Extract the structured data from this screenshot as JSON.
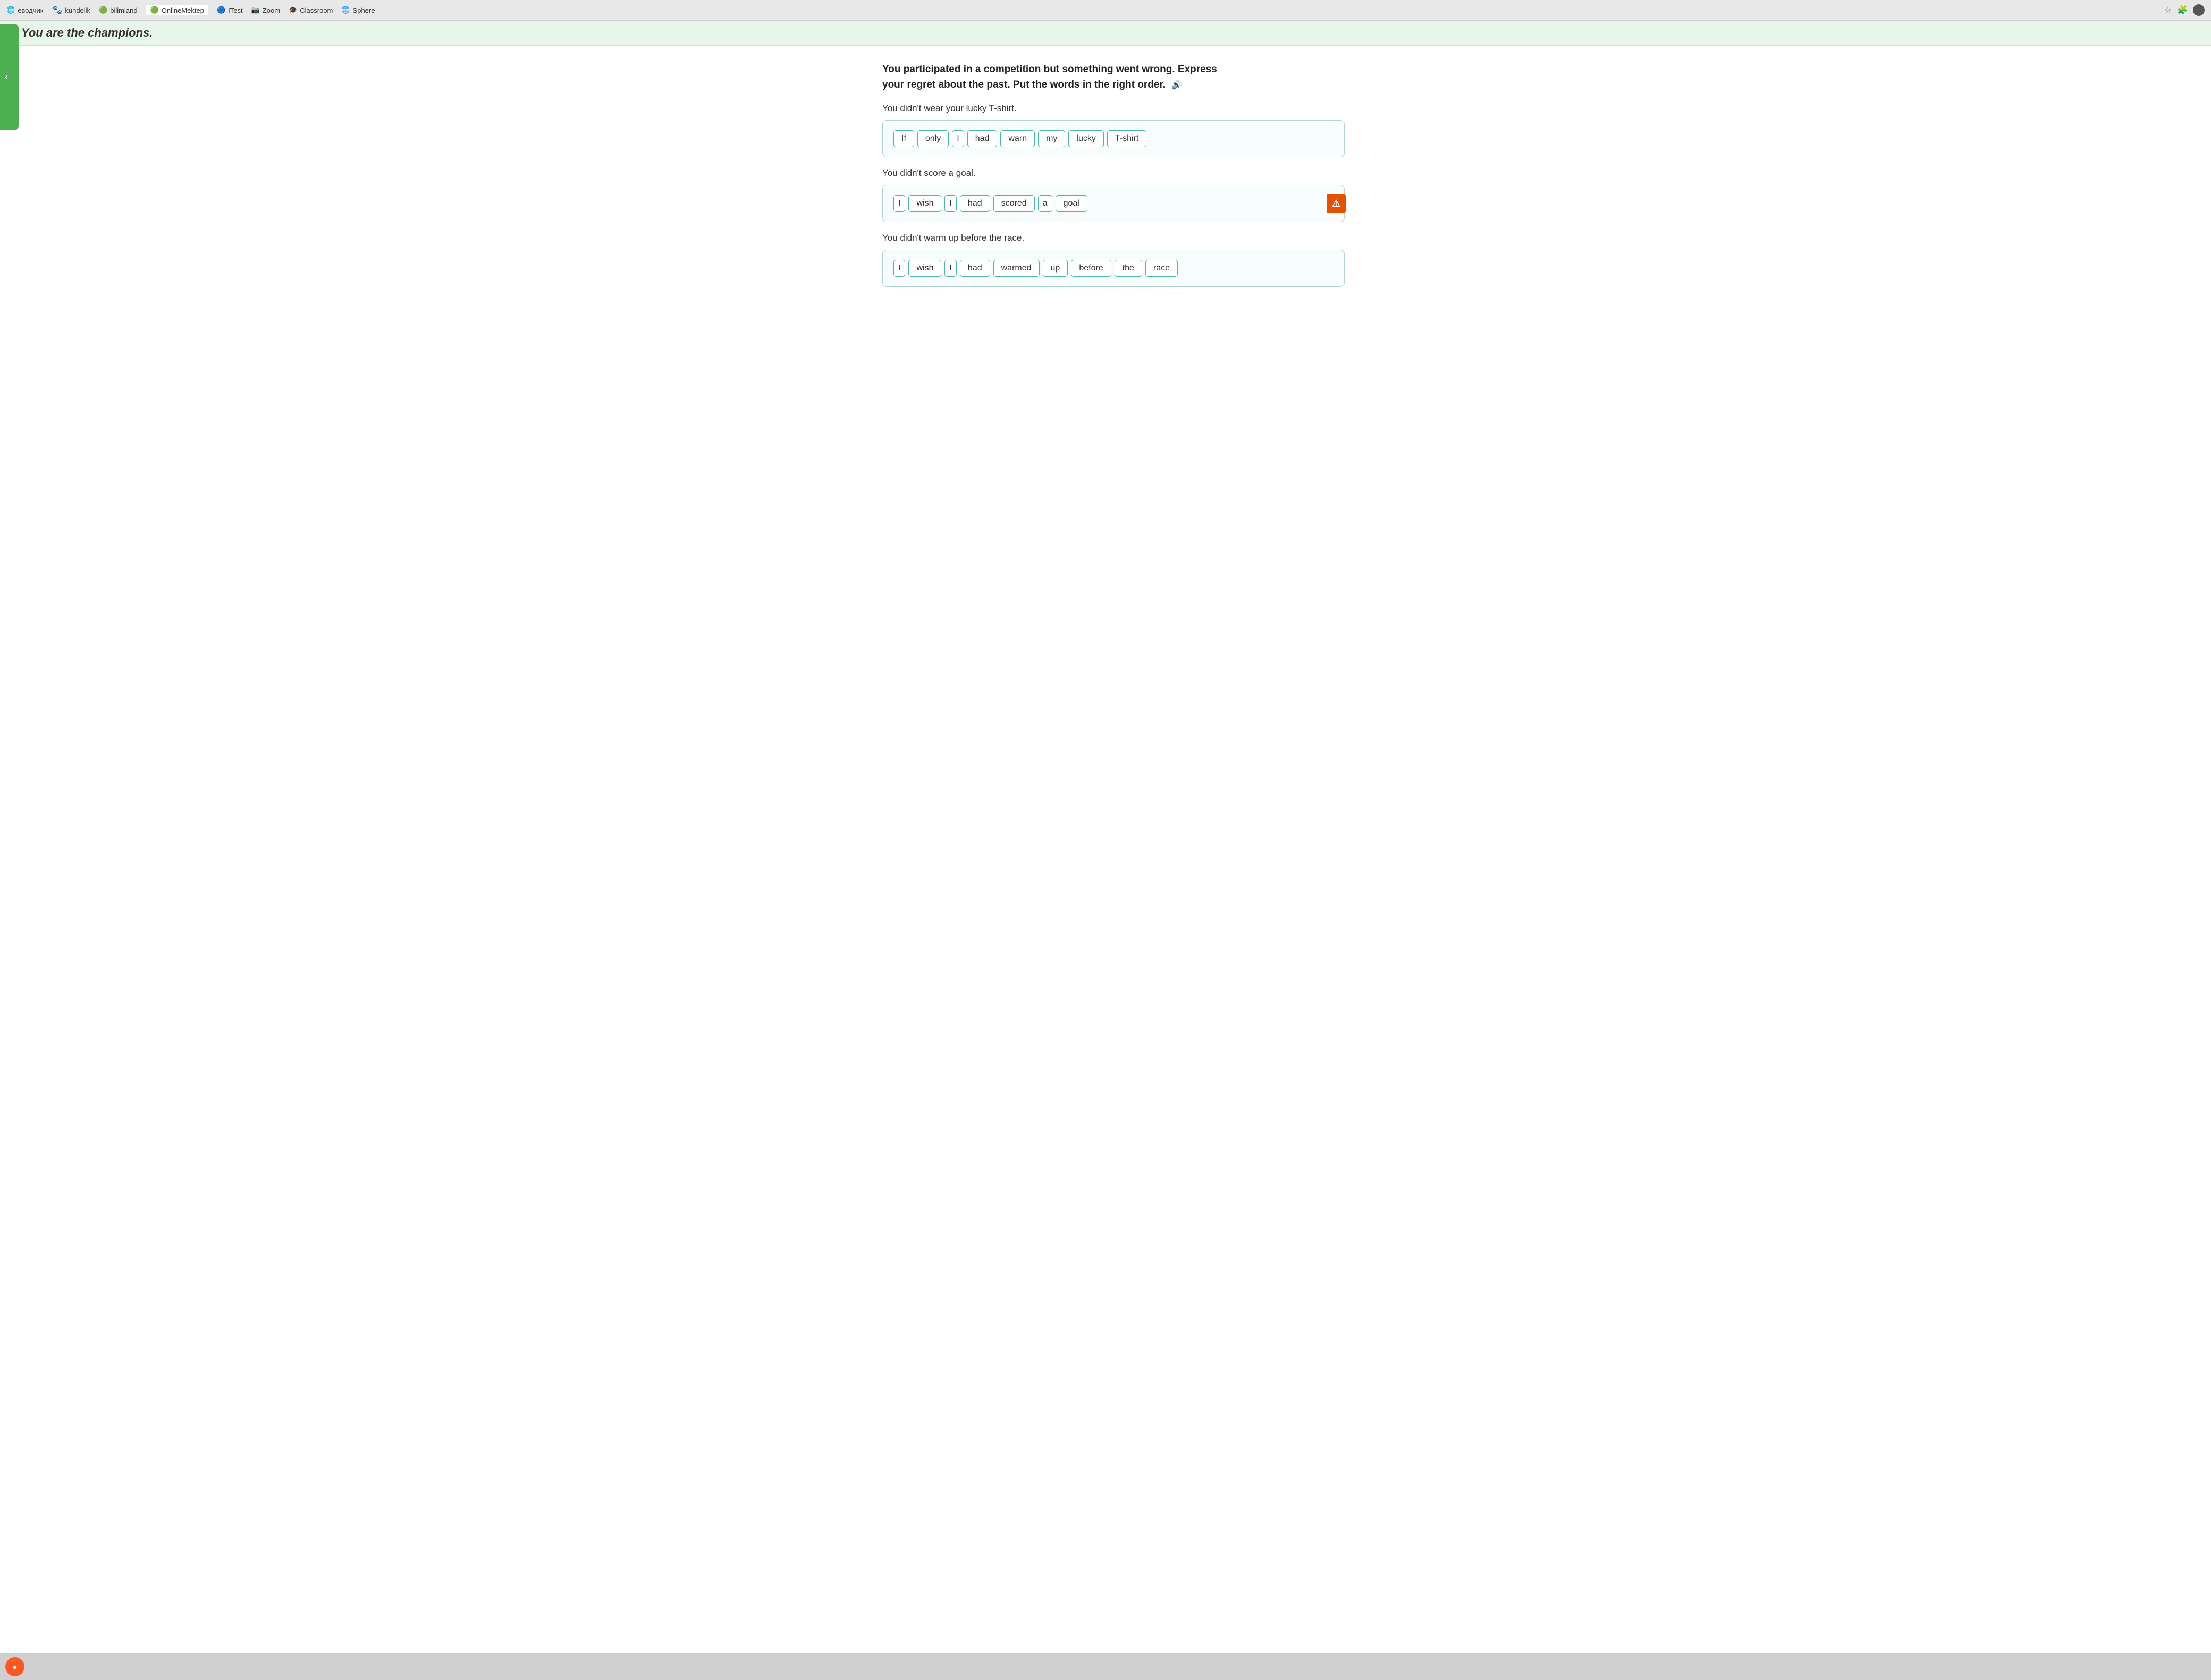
{
  "browser": {
    "items": [
      {
        "label": "еводчик",
        "icon": "translate-icon"
      },
      {
        "label": "kundelik",
        "icon": "kundelik-icon"
      },
      {
        "label": "bilimland",
        "icon": "bilimland-icon"
      },
      {
        "label": "OnlineMektep",
        "icon": "onlinemektep-icon"
      },
      {
        "label": "ITest",
        "icon": "itest-icon"
      },
      {
        "label": "Zoom",
        "icon": "zoom-icon"
      },
      {
        "label": "Classroom",
        "icon": "classroom-icon"
      },
      {
        "label": "Sphere",
        "icon": "sphere-icon"
      }
    ]
  },
  "top_title": "You are the champions.",
  "instructions": {
    "line1": "You participated in a competition but something went wrong. Express",
    "line2": "your regret about the past. Put the words in the right order."
  },
  "exercises": [
    {
      "id": 1,
      "sentence": "You didn't wear your lucky T-shirt.",
      "words": [
        "If",
        "only",
        "I",
        "had",
        "warn",
        "my",
        "lucky",
        "T-shirt"
      ]
    },
    {
      "id": 2,
      "sentence": "You didn't score a goal.",
      "words": [
        "I",
        "wish",
        "I",
        "had",
        "scored",
        "a",
        "goal"
      ],
      "has_alert": true
    },
    {
      "id": 3,
      "sentence": "You didn't warm up before the race.",
      "words": [
        "I",
        "wish",
        "I",
        "had",
        "warmed",
        "up",
        "before",
        "the",
        "race"
      ]
    }
  ],
  "icons": {
    "speaker": "🔊",
    "alert": "⚠",
    "chevron_left": "^",
    "star": "☆",
    "puzzle": "🧩"
  }
}
